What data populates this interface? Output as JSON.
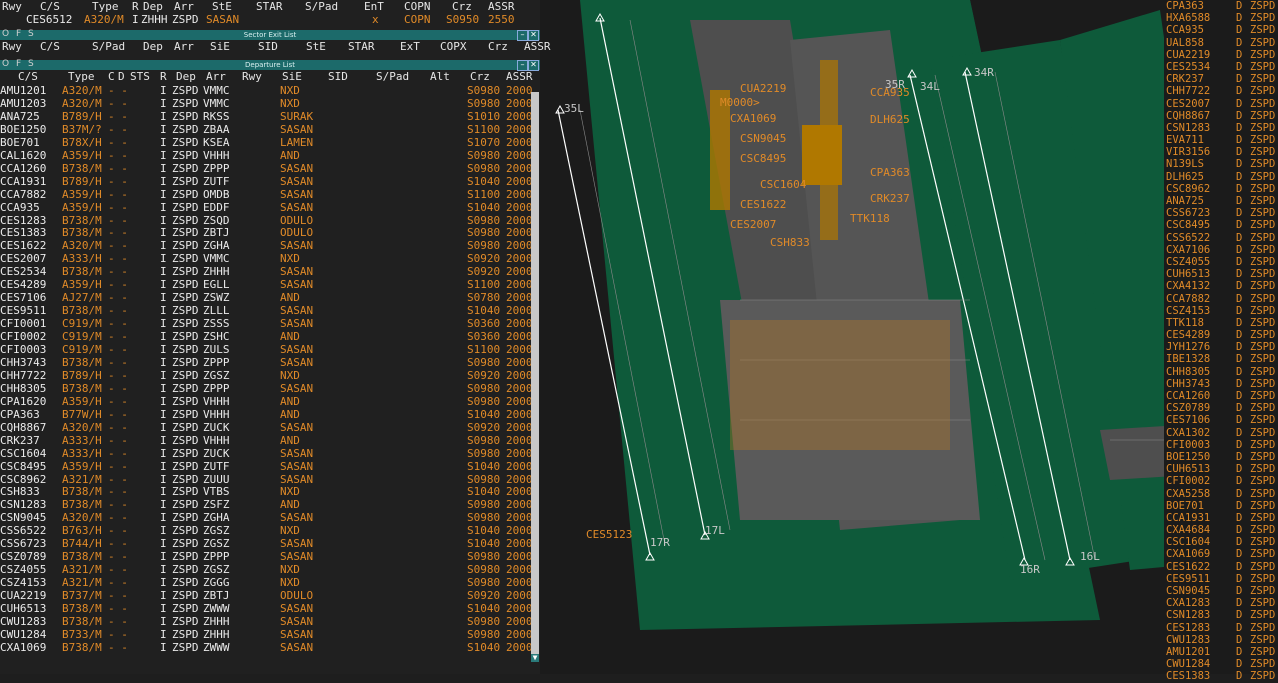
{
  "top_list": {
    "headers": [
      "Rwy",
      "C/S",
      "Type",
      "R",
      "Dep",
      "Arr",
      "StE",
      "STAR",
      "S/Pad",
      "EnT",
      "COPN",
      "Crz",
      "ASSR"
    ],
    "row": {
      "cs": "CES6512",
      "type": "A320/M",
      "r": "I",
      "dep": "ZHHH",
      "arr": "ZSPD",
      "ste": "SASAN",
      "ent": "x",
      "copn": "COPN",
      "crz": "S0950",
      "assr": "2550"
    }
  },
  "sector_exit": {
    "title": "Sector Exit List",
    "ofs": "O F S",
    "headers": [
      "Rwy",
      "C/S",
      "S/Pad",
      "Dep",
      "Arr",
      "SiE",
      "SID",
      "StE",
      "STAR",
      "ExT",
      "COPX",
      "Crz",
      "ASSR"
    ]
  },
  "departure": {
    "title": "Departure List",
    "ofs": "O F S",
    "headers": [
      "C/S",
      "Type",
      "C",
      "D",
      "STS",
      "R",
      "Dep",
      "Arr",
      "Rwy",
      "SiE",
      "SID",
      "S/Pad",
      "Alt",
      "Crz",
      "ASSR"
    ],
    "rows": [
      {
        "cs": "AMU1201",
        "type": "A320/M",
        "cd": "- -",
        "r": "I",
        "dep": "ZSPD",
        "arr": "VMMC",
        "sie": "NXD",
        "crz": "S0980",
        "assr": "2000"
      },
      {
        "cs": "AMU1203",
        "type": "A320/M",
        "cd": "- -",
        "r": "I",
        "dep": "ZSPD",
        "arr": "VMMC",
        "sie": "NXD",
        "crz": "S0980",
        "assr": "2000"
      },
      {
        "cs": "ANA725",
        "type": "B789/H",
        "cd": "- -",
        "r": "I",
        "dep": "ZSPD",
        "arr": "RKSS",
        "sie": "SURAK",
        "crz": "S1010",
        "assr": "2000"
      },
      {
        "cs": "BOE1250",
        "type": "B37M/?",
        "cd": "- -",
        "r": "I",
        "dep": "ZSPD",
        "arr": "ZBAA",
        "sie": "SASAN",
        "crz": "S1100",
        "assr": "2000"
      },
      {
        "cs": "BOE701",
        "type": "B78X/H",
        "cd": "- -",
        "r": "I",
        "dep": "ZSPD",
        "arr": "KSEA",
        "sie": "LAMEN",
        "crz": "S1070",
        "assr": "2000"
      },
      {
        "cs": "CAL1620",
        "type": "A359/H",
        "cd": "- -",
        "r": "I",
        "dep": "ZSPD",
        "arr": "VHHH",
        "sie": "AND",
        "crz": "S0980",
        "assr": "2000"
      },
      {
        "cs": "CCA1260",
        "type": "B738/M",
        "cd": "- -",
        "r": "I",
        "dep": "ZSPD",
        "arr": "ZPPP",
        "sie": "SASAN",
        "crz": "S0980",
        "assr": "2000"
      },
      {
        "cs": "CCA1931",
        "type": "B789/H",
        "cd": "- -",
        "r": "I",
        "dep": "ZSPD",
        "arr": "ZUTF",
        "sie": "SASAN",
        "crz": "S1040",
        "assr": "2000"
      },
      {
        "cs": "CCA7882",
        "type": "A359/H",
        "cd": "- -",
        "r": "I",
        "dep": "ZSPD",
        "arr": "OMDB",
        "sie": "SASAN",
        "crz": "S1100",
        "assr": "2000"
      },
      {
        "cs": "CCA935",
        "type": "A359/H",
        "cd": "- -",
        "r": "I",
        "dep": "ZSPD",
        "arr": "EDDF",
        "sie": "SASAN",
        "crz": "S1040",
        "assr": "2000"
      },
      {
        "cs": "CES1283",
        "type": "B738/M",
        "cd": "- -",
        "r": "I",
        "dep": "ZSPD",
        "arr": "ZSQD",
        "sie": "ODULO",
        "crz": "S0980",
        "assr": "2000"
      },
      {
        "cs": "CES1383",
        "type": "B738/M",
        "cd": "- -",
        "r": "I",
        "dep": "ZSPD",
        "arr": "ZBTJ",
        "sie": "ODULO",
        "crz": "S0980",
        "assr": "2000"
      },
      {
        "cs": "CES1622",
        "type": "A320/M",
        "cd": "- -",
        "r": "I",
        "dep": "ZSPD",
        "arr": "ZGHA",
        "sie": "SASAN",
        "crz": "S0980",
        "assr": "2000"
      },
      {
        "cs": "CES2007",
        "type": "A333/H",
        "cd": "- -",
        "r": "I",
        "dep": "ZSPD",
        "arr": "VMMC",
        "sie": "NXD",
        "crz": "S0920",
        "assr": "2000"
      },
      {
        "cs": "CES2534",
        "type": "B738/M",
        "cd": "- -",
        "r": "I",
        "dep": "ZSPD",
        "arr": "ZHHH",
        "sie": "SASAN",
        "crz": "S0920",
        "assr": "2000"
      },
      {
        "cs": "CES4289",
        "type": "A359/H",
        "cd": "- -",
        "r": "I",
        "dep": "ZSPD",
        "arr": "EGLL",
        "sie": "SASAN",
        "crz": "S1100",
        "assr": "2000"
      },
      {
        "cs": "CES7106",
        "type": "AJ27/M",
        "cd": "- -",
        "r": "I",
        "dep": "ZSPD",
        "arr": "ZSWZ",
        "sie": "AND",
        "crz": "S0780",
        "assr": "2000"
      },
      {
        "cs": "CES9511",
        "type": "B738/M",
        "cd": "- -",
        "r": "I",
        "dep": "ZSPD",
        "arr": "ZLLL",
        "sie": "SASAN",
        "crz": "S1040",
        "assr": "2000"
      },
      {
        "cs": "CFI0001",
        "type": "C919/M",
        "cd": "- -",
        "r": "I",
        "dep": "ZSPD",
        "arr": "ZSSS",
        "sie": "SASAN",
        "crz": "S0360",
        "assr": "2000"
      },
      {
        "cs": "CFI0002",
        "type": "C919/M",
        "cd": "- -",
        "r": "I",
        "dep": "ZSPD",
        "arr": "ZSHC",
        "sie": "AND",
        "crz": "S0360",
        "assr": "2000"
      },
      {
        "cs": "CFI0003",
        "type": "C919/M",
        "cd": "- -",
        "r": "I",
        "dep": "ZSPD",
        "arr": "ZULS",
        "sie": "SASAN",
        "crz": "S1100",
        "assr": "2000"
      },
      {
        "cs": "CHH3743",
        "type": "B738/M",
        "cd": "- -",
        "r": "I",
        "dep": "ZSPD",
        "arr": "ZPPP",
        "sie": "SASAN",
        "crz": "S0980",
        "assr": "2000"
      },
      {
        "cs": "CHH7722",
        "type": "B789/H",
        "cd": "- -",
        "r": "I",
        "dep": "ZSPD",
        "arr": "ZGSZ",
        "sie": "NXD",
        "crz": "S0920",
        "assr": "2000"
      },
      {
        "cs": "CHH8305",
        "type": "B738/M",
        "cd": "- -",
        "r": "I",
        "dep": "ZSPD",
        "arr": "ZPPP",
        "sie": "SASAN",
        "crz": "S0980",
        "assr": "2000"
      },
      {
        "cs": "CPA1620",
        "type": "A359/H",
        "cd": "- -",
        "r": "I",
        "dep": "ZSPD",
        "arr": "VHHH",
        "sie": "AND",
        "crz": "S0980",
        "assr": "2000"
      },
      {
        "cs": "CPA363",
        "type": "B77W/H",
        "cd": "- -",
        "r": "I",
        "dep": "ZSPD",
        "arr": "VHHH",
        "sie": "AND",
        "crz": "S1040",
        "assr": "2000"
      },
      {
        "cs": "CQH8867",
        "type": "A320/M",
        "cd": "- -",
        "r": "I",
        "dep": "ZSPD",
        "arr": "ZUCK",
        "sie": "SASAN",
        "crz": "S0920",
        "assr": "2000"
      },
      {
        "cs": "CRK237",
        "type": "A333/H",
        "cd": "- -",
        "r": "I",
        "dep": "ZSPD",
        "arr": "VHHH",
        "sie": "AND",
        "crz": "S0980",
        "assr": "2000"
      },
      {
        "cs": "CSC1604",
        "type": "A333/H",
        "cd": "- -",
        "r": "I",
        "dep": "ZSPD",
        "arr": "ZUCK",
        "sie": "SASAN",
        "crz": "S0980",
        "assr": "2000"
      },
      {
        "cs": "CSC8495",
        "type": "A359/H",
        "cd": "- -",
        "r": "I",
        "dep": "ZSPD",
        "arr": "ZUTF",
        "sie": "SASAN",
        "crz": "S1040",
        "assr": "2000"
      },
      {
        "cs": "CSC8962",
        "type": "A321/M",
        "cd": "- -",
        "r": "I",
        "dep": "ZSPD",
        "arr": "ZUUU",
        "sie": "SASAN",
        "crz": "S0980",
        "assr": "2000"
      },
      {
        "cs": "CSH833",
        "type": "B738/M",
        "cd": "- -",
        "r": "I",
        "dep": "ZSPD",
        "arr": "VTBS",
        "sie": "NXD",
        "crz": "S1040",
        "assr": "2000"
      },
      {
        "cs": "CSN1283",
        "type": "B738/M",
        "cd": "- -",
        "r": "I",
        "dep": "ZSPD",
        "arr": "ZSFZ",
        "sie": "AND",
        "crz": "S0980",
        "assr": "2000"
      },
      {
        "cs": "CSN9045",
        "type": "A320/M",
        "cd": "- -",
        "r": "I",
        "dep": "ZSPD",
        "arr": "ZGHA",
        "sie": "SASAN",
        "crz": "S0980",
        "assr": "2000"
      },
      {
        "cs": "CSS6522",
        "type": "B763/H",
        "cd": "- -",
        "r": "I",
        "dep": "ZSPD",
        "arr": "ZGSZ",
        "sie": "NXD",
        "crz": "S1040",
        "assr": "2000"
      },
      {
        "cs": "CSS6723",
        "type": "B744/H",
        "cd": "- -",
        "r": "I",
        "dep": "ZSPD",
        "arr": "ZGSZ",
        "sie": "SASAN",
        "crz": "S1040",
        "assr": "2000"
      },
      {
        "cs": "CSZ0789",
        "type": "B738/M",
        "cd": "- -",
        "r": "I",
        "dep": "ZSPD",
        "arr": "ZPPP",
        "sie": "SASAN",
        "crz": "S0980",
        "assr": "2000"
      },
      {
        "cs": "CSZ4055",
        "type": "A321/M",
        "cd": "- -",
        "r": "I",
        "dep": "ZSPD",
        "arr": "ZGSZ",
        "sie": "NXD",
        "crz": "S0980",
        "assr": "2000"
      },
      {
        "cs": "CSZ4153",
        "type": "A321/M",
        "cd": "- -",
        "r": "I",
        "dep": "ZSPD",
        "arr": "ZGGG",
        "sie": "NXD",
        "crz": "S0980",
        "assr": "2000"
      },
      {
        "cs": "CUA2219",
        "type": "B737/M",
        "cd": "- -",
        "r": "I",
        "dep": "ZSPD",
        "arr": "ZBTJ",
        "sie": "ODULO",
        "crz": "S0920",
        "assr": "2000"
      },
      {
        "cs": "CUH6513",
        "type": "B738/M",
        "cd": "- -",
        "r": "I",
        "dep": "ZSPD",
        "arr": "ZWWW",
        "sie": "SASAN",
        "crz": "S1040",
        "assr": "2000"
      },
      {
        "cs": "CWU1283",
        "type": "B738/M",
        "cd": "- -",
        "r": "I",
        "dep": "ZSPD",
        "arr": "ZHHH",
        "sie": "SASAN",
        "crz": "S0980",
        "assr": "2000"
      },
      {
        "cs": "CWU1284",
        "type": "B733/M",
        "cd": "- -",
        "r": "I",
        "dep": "ZSPD",
        "arr": "ZHHH",
        "sie": "SASAN",
        "crz": "S0980",
        "assr": "2000"
      },
      {
        "cs": "CXA1069",
        "type": "B738/M",
        "cd": "- -",
        "r": "I",
        "dep": "ZSPD",
        "arr": "ZWWW",
        "sie": "SASAN",
        "crz": "S1040",
        "assr": "2000"
      }
    ]
  },
  "right_list": [
    "CPA363",
    "HXA6588",
    "CCA935",
    "UAL858",
    "CUA2219",
    "CES2534",
    "CRK237",
    "CHH7722",
    "CES2007",
    "CQH8867",
    "CSN1283",
    "EVA711",
    "VIR3156",
    "N139LS",
    "DLH625",
    "CSC8962",
    "ANA725",
    "CSS6723",
    "CSC8495",
    "CSS6522",
    "CXA7106",
    "CSZ4055",
    "CUH6513",
    "CXA4132",
    "CCA7882",
    "CSZ4153",
    "TTK118",
    "CES4289",
    "JYH1276",
    "IBE1328",
    "CHH8305",
    "CHH3743",
    "CCA1260",
    "CSZ0789",
    "CES7106",
    "CXA1302",
    "CFI0003",
    "BOE1250",
    "CUH6513",
    "CFI0002",
    "CXA5258",
    "BOE701",
    "CCA1931",
    "CXA4684",
    "CSC1604",
    "CXA1069",
    "CES1622",
    "CES9511",
    "CSN9045",
    "CXA1283",
    "CSN1283",
    "CES1283",
    "CWU1283",
    "AMU1201",
    "CWU1284",
    "CES1383"
  ],
  "right_list_d": "D",
  "right_list_ap": "ZSPD",
  "map": {
    "runway_labels": [
      "35L",
      "34R",
      "35R",
      "34L",
      "17R",
      "16R",
      "17L",
      "16L"
    ],
    "labels": [
      "CUA2219",
      "M0000>",
      "CXA1069",
      "CSN9045",
      "CSC8495",
      "CSC1604",
      "CES1622",
      "CES2007",
      "CSH833",
      "CCA935",
      "DLH625",
      "CPA363",
      "CRK237",
      "TTK118",
      "CES5123"
    ]
  },
  "colors": {
    "accent": "#1c6a6a",
    "grass": "#0e5a3a",
    "taxi": "#5a5a5a",
    "label_orange": "#e08a28",
    "label_yellow": "#e8e84a"
  }
}
